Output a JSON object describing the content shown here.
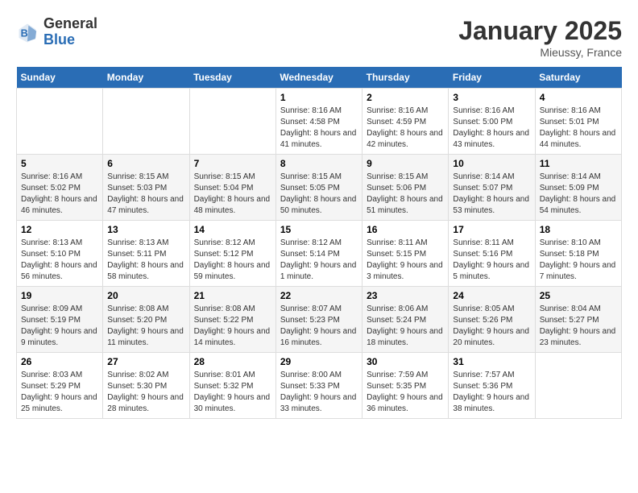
{
  "header": {
    "logo_general": "General",
    "logo_blue": "Blue",
    "month": "January 2025",
    "location": "Mieussy, France"
  },
  "weekdays": [
    "Sunday",
    "Monday",
    "Tuesday",
    "Wednesday",
    "Thursday",
    "Friday",
    "Saturday"
  ],
  "weeks": [
    [
      {
        "day": "",
        "info": ""
      },
      {
        "day": "",
        "info": ""
      },
      {
        "day": "",
        "info": ""
      },
      {
        "day": "1",
        "info": "Sunrise: 8:16 AM\nSunset: 4:58 PM\nDaylight: 8 hours and 41 minutes."
      },
      {
        "day": "2",
        "info": "Sunrise: 8:16 AM\nSunset: 4:59 PM\nDaylight: 8 hours and 42 minutes."
      },
      {
        "day": "3",
        "info": "Sunrise: 8:16 AM\nSunset: 5:00 PM\nDaylight: 8 hours and 43 minutes."
      },
      {
        "day": "4",
        "info": "Sunrise: 8:16 AM\nSunset: 5:01 PM\nDaylight: 8 hours and 44 minutes."
      }
    ],
    [
      {
        "day": "5",
        "info": "Sunrise: 8:16 AM\nSunset: 5:02 PM\nDaylight: 8 hours and 46 minutes."
      },
      {
        "day": "6",
        "info": "Sunrise: 8:15 AM\nSunset: 5:03 PM\nDaylight: 8 hours and 47 minutes."
      },
      {
        "day": "7",
        "info": "Sunrise: 8:15 AM\nSunset: 5:04 PM\nDaylight: 8 hours and 48 minutes."
      },
      {
        "day": "8",
        "info": "Sunrise: 8:15 AM\nSunset: 5:05 PM\nDaylight: 8 hours and 50 minutes."
      },
      {
        "day": "9",
        "info": "Sunrise: 8:15 AM\nSunset: 5:06 PM\nDaylight: 8 hours and 51 minutes."
      },
      {
        "day": "10",
        "info": "Sunrise: 8:14 AM\nSunset: 5:07 PM\nDaylight: 8 hours and 53 minutes."
      },
      {
        "day": "11",
        "info": "Sunrise: 8:14 AM\nSunset: 5:09 PM\nDaylight: 8 hours and 54 minutes."
      }
    ],
    [
      {
        "day": "12",
        "info": "Sunrise: 8:13 AM\nSunset: 5:10 PM\nDaylight: 8 hours and 56 minutes."
      },
      {
        "day": "13",
        "info": "Sunrise: 8:13 AM\nSunset: 5:11 PM\nDaylight: 8 hours and 58 minutes."
      },
      {
        "day": "14",
        "info": "Sunrise: 8:12 AM\nSunset: 5:12 PM\nDaylight: 8 hours and 59 minutes."
      },
      {
        "day": "15",
        "info": "Sunrise: 8:12 AM\nSunset: 5:14 PM\nDaylight: 9 hours and 1 minute."
      },
      {
        "day": "16",
        "info": "Sunrise: 8:11 AM\nSunset: 5:15 PM\nDaylight: 9 hours and 3 minutes."
      },
      {
        "day": "17",
        "info": "Sunrise: 8:11 AM\nSunset: 5:16 PM\nDaylight: 9 hours and 5 minutes."
      },
      {
        "day": "18",
        "info": "Sunrise: 8:10 AM\nSunset: 5:18 PM\nDaylight: 9 hours and 7 minutes."
      }
    ],
    [
      {
        "day": "19",
        "info": "Sunrise: 8:09 AM\nSunset: 5:19 PM\nDaylight: 9 hours and 9 minutes."
      },
      {
        "day": "20",
        "info": "Sunrise: 8:08 AM\nSunset: 5:20 PM\nDaylight: 9 hours and 11 minutes."
      },
      {
        "day": "21",
        "info": "Sunrise: 8:08 AM\nSunset: 5:22 PM\nDaylight: 9 hours and 14 minutes."
      },
      {
        "day": "22",
        "info": "Sunrise: 8:07 AM\nSunset: 5:23 PM\nDaylight: 9 hours and 16 minutes."
      },
      {
        "day": "23",
        "info": "Sunrise: 8:06 AM\nSunset: 5:24 PM\nDaylight: 9 hours and 18 minutes."
      },
      {
        "day": "24",
        "info": "Sunrise: 8:05 AM\nSunset: 5:26 PM\nDaylight: 9 hours and 20 minutes."
      },
      {
        "day": "25",
        "info": "Sunrise: 8:04 AM\nSunset: 5:27 PM\nDaylight: 9 hours and 23 minutes."
      }
    ],
    [
      {
        "day": "26",
        "info": "Sunrise: 8:03 AM\nSunset: 5:29 PM\nDaylight: 9 hours and 25 minutes."
      },
      {
        "day": "27",
        "info": "Sunrise: 8:02 AM\nSunset: 5:30 PM\nDaylight: 9 hours and 28 minutes."
      },
      {
        "day": "28",
        "info": "Sunrise: 8:01 AM\nSunset: 5:32 PM\nDaylight: 9 hours and 30 minutes."
      },
      {
        "day": "29",
        "info": "Sunrise: 8:00 AM\nSunset: 5:33 PM\nDaylight: 9 hours and 33 minutes."
      },
      {
        "day": "30",
        "info": "Sunrise: 7:59 AM\nSunset: 5:35 PM\nDaylight: 9 hours and 36 minutes."
      },
      {
        "day": "31",
        "info": "Sunrise: 7:57 AM\nSunset: 5:36 PM\nDaylight: 9 hours and 38 minutes."
      },
      {
        "day": "",
        "info": ""
      }
    ]
  ]
}
